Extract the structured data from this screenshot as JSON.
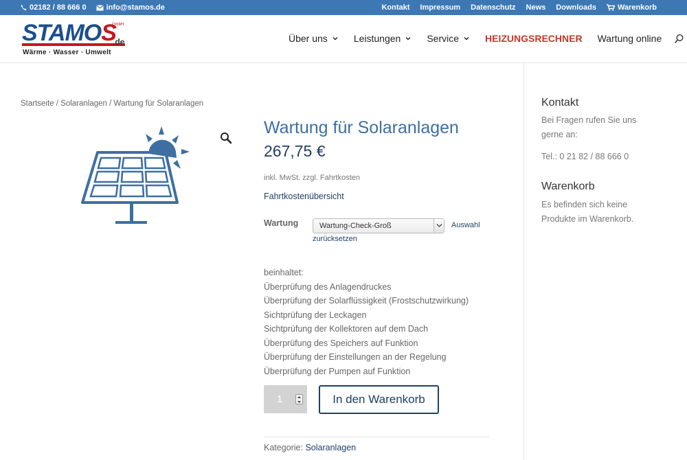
{
  "topbar": {
    "phone": "02182 / 88 666 0",
    "email": "info@stamos.de",
    "links": [
      "Kontakt",
      "Impressum",
      "Datenschutz",
      "News",
      "Downloads"
    ],
    "cart_label": "Warenkorb"
  },
  "logo": {
    "word": "STAMO",
    "word_end": "S",
    "tld": ".de",
    "gmbh": "GmbH",
    "tagline": "Wärme · Wasser · Umwelt"
  },
  "nav": {
    "items": [
      {
        "label": "Über uns",
        "has_dropdown": true
      },
      {
        "label": "Leistungen",
        "has_dropdown": true
      },
      {
        "label": "Service",
        "has_dropdown": true
      },
      {
        "label": "HEIZUNGSRECHNER",
        "has_dropdown": false,
        "highlight": true
      },
      {
        "label": "Wartung online",
        "has_dropdown": false
      }
    ],
    "search_icon": "search-icon"
  },
  "breadcrumb": "Startseite / Solaranlagen / Wartung für Solaranlagen",
  "product": {
    "title": "Wartung für Solaranlagen",
    "price": "267,75 €",
    "tax_note": "inkl. MwSt. zzgl. Fahrtkosten",
    "cost_link": "Fahrtkostenübersicht",
    "variant_label": "Wartung",
    "variant_selected": "Wartung-Check-Groß",
    "reset_part1": "Auswahl",
    "reset_part2": "zurücksetzen",
    "includes": [
      "beinhaltet:",
      "Überprüfung des Anlagendruckes",
      "Überprüfung der Solarflüssigkeit (Frostschutzwirkung)",
      "Sichtprüfung der Leckagen",
      "Sichtprüfung der Kollektoren auf dem Dach",
      "Überprüfung des Speichers auf Funktion",
      "Überprüfung der Einstellungen an der Regelung",
      "Überprüfung der Pumpen auf Funktion"
    ],
    "quantity": "1",
    "add_to_cart": "In den Warenkorb",
    "category_label": "Kategorie:",
    "category_value": "Solaranlagen"
  },
  "sidebar": {
    "contact_heading": "Kontakt",
    "contact_text": [
      "Bei Fragen rufen Sie uns",
      "gerne an:"
    ],
    "contact_phone": "Tel.: 0 21 82 / 88 666 0",
    "cart_heading": "Warenkorb",
    "cart_text": [
      "Es befinden sich keine",
      "Produkte im Warenkorb."
    ]
  },
  "colors": {
    "topbar": "#3d78b5",
    "accent": "#1f3f66",
    "highlight": "#c0392b",
    "title": "#3d6fa3"
  }
}
